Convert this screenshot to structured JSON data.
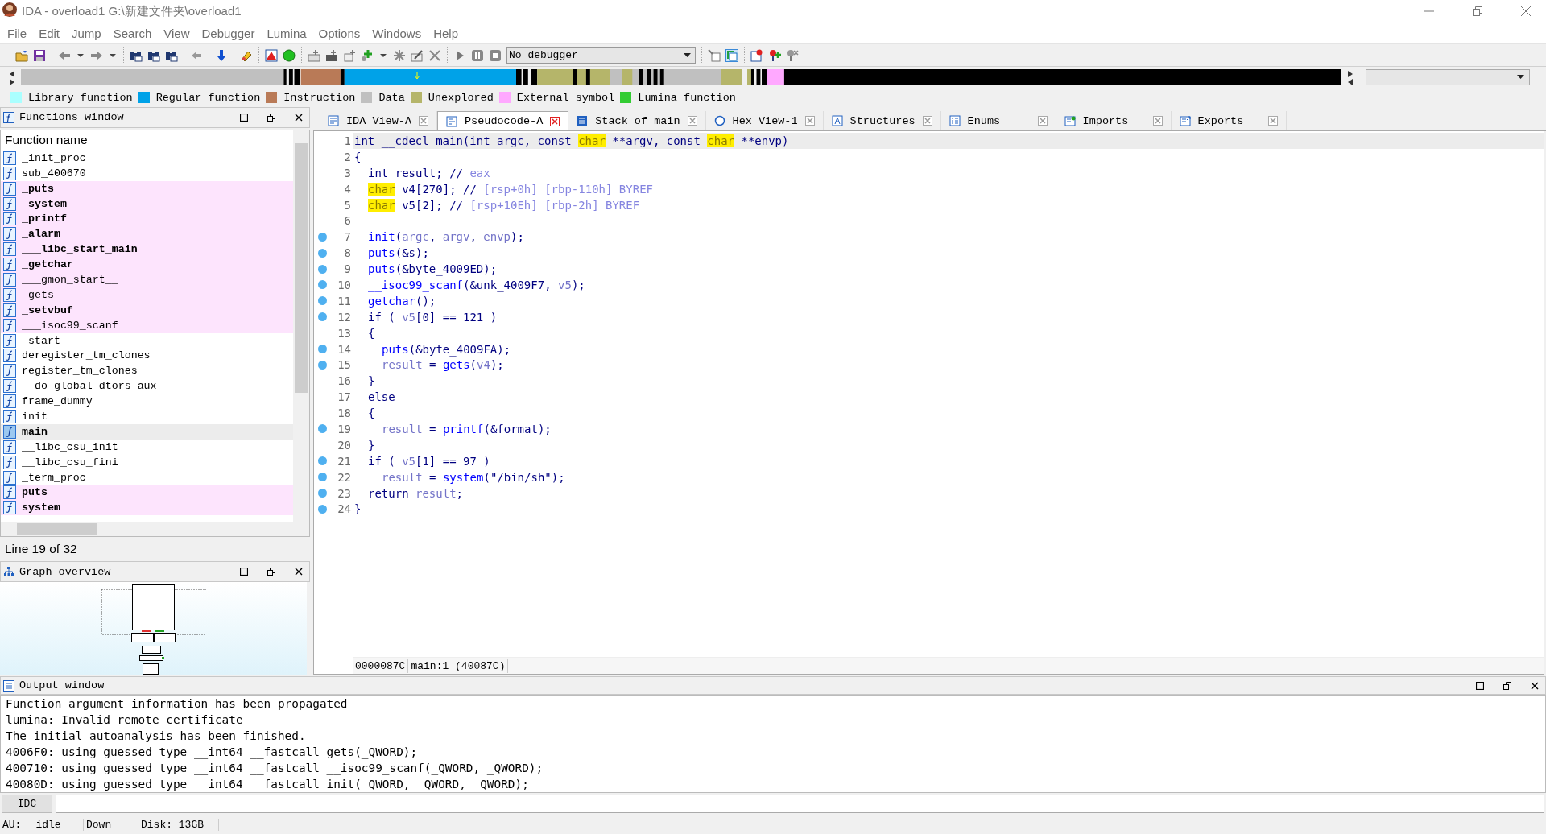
{
  "window": {
    "title": "IDA - overload1 G:\\新建文件夹\\overload1"
  },
  "menu": [
    "File",
    "Edit",
    "Jump",
    "Search",
    "View",
    "Debugger",
    "Lumina",
    "Options",
    "Windows",
    "Help"
  ],
  "toolbar": {
    "debugger_select": "No debugger"
  },
  "legend": [
    {
      "label": "Library function",
      "color": "#aaffff"
    },
    {
      "label": "Regular function",
      "color": "#00a2e8"
    },
    {
      "label": "Instruction",
      "color": "#b97a57"
    },
    {
      "label": "Data",
      "color": "#c0c0c0"
    },
    {
      "label": "Unexplored",
      "color": "#b5b56a"
    },
    {
      "label": "External symbol",
      "color": "#ffa8ff"
    },
    {
      "label": "Lumina function",
      "color": "#33cc33"
    }
  ],
  "functions_window": {
    "title": "Functions window",
    "column": "Function name",
    "status": "Line 19 of 32",
    "rows": [
      {
        "name": "_init_proc",
        "external": false,
        "bold": false,
        "selected": false
      },
      {
        "name": "sub_400670",
        "external": false,
        "bold": false,
        "selected": false
      },
      {
        "name": "_puts",
        "external": true,
        "bold": true,
        "selected": false
      },
      {
        "name": "_system",
        "external": true,
        "bold": true,
        "selected": false
      },
      {
        "name": "_printf",
        "external": true,
        "bold": true,
        "selected": false
      },
      {
        "name": "_alarm",
        "external": true,
        "bold": true,
        "selected": false
      },
      {
        "name": "___libc_start_main",
        "external": true,
        "bold": true,
        "selected": false
      },
      {
        "name": "_getchar",
        "external": true,
        "bold": true,
        "selected": false
      },
      {
        "name": "___gmon_start__",
        "external": true,
        "bold": false,
        "selected": false
      },
      {
        "name": "_gets",
        "external": true,
        "bold": false,
        "selected": false
      },
      {
        "name": "_setvbuf",
        "external": true,
        "bold": true,
        "selected": false
      },
      {
        "name": "___isoc99_scanf",
        "external": true,
        "bold": false,
        "selected": false
      },
      {
        "name": "_start",
        "external": false,
        "bold": false,
        "selected": false
      },
      {
        "name": "deregister_tm_clones",
        "external": false,
        "bold": false,
        "selected": false
      },
      {
        "name": "register_tm_clones",
        "external": false,
        "bold": false,
        "selected": false
      },
      {
        "name": "__do_global_dtors_aux",
        "external": false,
        "bold": false,
        "selected": false
      },
      {
        "name": "frame_dummy",
        "external": false,
        "bold": false,
        "selected": false
      },
      {
        "name": "init",
        "external": false,
        "bold": false,
        "selected": false
      },
      {
        "name": "main",
        "external": false,
        "bold": true,
        "selected": true
      },
      {
        "name": "__libc_csu_init",
        "external": false,
        "bold": false,
        "selected": false
      },
      {
        "name": "__libc_csu_fini",
        "external": false,
        "bold": false,
        "selected": false
      },
      {
        "name": "_term_proc",
        "external": false,
        "bold": false,
        "selected": false
      },
      {
        "name": "puts",
        "external": true,
        "bold": true,
        "selected": false
      },
      {
        "name": "system",
        "external": true,
        "bold": true,
        "selected": false
      }
    ]
  },
  "graph_overview": {
    "title": "Graph overview"
  },
  "tabs": [
    {
      "label": "IDA View-A",
      "kind": "disasm",
      "selected": false
    },
    {
      "label": "Pseudocode-A",
      "kind": "pseudocode",
      "selected": true
    },
    {
      "label": "Stack of main",
      "kind": "stack",
      "selected": false
    },
    {
      "label": "Hex View-1",
      "kind": "hex",
      "selected": false
    },
    {
      "label": "Structures",
      "kind": "struct",
      "selected": false
    },
    {
      "label": "Enums",
      "kind": "enum",
      "selected": false
    },
    {
      "label": "Imports",
      "kind": "import",
      "selected": false
    },
    {
      "label": "Exports",
      "kind": "export",
      "selected": false
    }
  ],
  "code": {
    "lines": [
      {
        "number": "1",
        "kind": "top",
        "marker": false,
        "selected": true,
        "tokens": [
          {
            "kind": "text",
            "s": "int __cdecl main(int argc, const "
          },
          {
            "kind": "highlight",
            "s": "char"
          },
          {
            "kind": "text",
            "s": " **argv, const "
          },
          {
            "kind": "highlight",
            "s": "char"
          },
          {
            "kind": "text",
            "s": " **envp)"
          }
        ]
      },
      {
        "number": "2",
        "kind": "top",
        "marker": false,
        "selected": false,
        "tokens": [
          {
            "kind": "text",
            "s": "{"
          }
        ]
      },
      {
        "number": "3",
        "kind": "body",
        "marker": false,
        "selected": false,
        "tokens": [
          {
            "kind": "text",
            "s": "int result; // "
          },
          {
            "kind": "comment",
            "s": "eax"
          }
        ]
      },
      {
        "number": "4",
        "kind": "body",
        "marker": false,
        "selected": false,
        "tokens": [
          {
            "kind": "highlight",
            "s": "char"
          },
          {
            "kind": "text",
            "s": " v4[270]; // "
          },
          {
            "kind": "comment",
            "s": "[rsp+0h] [rbp-110h] BYREF"
          }
        ]
      },
      {
        "number": "5",
        "kind": "body",
        "marker": false,
        "selected": false,
        "tokens": [
          {
            "kind": "highlight",
            "s": "char"
          },
          {
            "kind": "text",
            "s": " v5[2]; // "
          },
          {
            "kind": "comment",
            "s": "[rsp+10Eh] [rbp-2h] BYREF"
          }
        ]
      },
      {
        "number": "6",
        "kind": "body",
        "marker": false,
        "selected": false
      },
      {
        "number": "7",
        "kind": "body",
        "marker": true,
        "selected": false,
        "tokens": [
          {
            "kind": "func",
            "s": "init"
          },
          {
            "kind": "text",
            "s": "("
          },
          {
            "kind": "var",
            "s": "argc"
          },
          {
            "kind": "text",
            "s": ", "
          },
          {
            "kind": "var",
            "s": "argv"
          },
          {
            "kind": "text",
            "s": ", "
          },
          {
            "kind": "var",
            "s": "envp"
          },
          {
            "kind": "text",
            "s": ");"
          }
        ]
      },
      {
        "number": "8",
        "kind": "body",
        "marker": true,
        "selected": false,
        "tokens": [
          {
            "kind": "func",
            "s": "puts"
          },
          {
            "kind": "text",
            "s": "(&s);"
          }
        ]
      },
      {
        "number": "9",
        "kind": "body",
        "marker": true,
        "selected": false,
        "tokens": [
          {
            "kind": "func",
            "s": "puts"
          },
          {
            "kind": "text",
            "s": "(&byte_4009ED);"
          }
        ]
      },
      {
        "number": "10",
        "kind": "body",
        "marker": true,
        "selected": false,
        "tokens": [
          {
            "kind": "func",
            "s": "__isoc99_scanf"
          },
          {
            "kind": "text",
            "s": "(&unk_4009F7, "
          },
          {
            "kind": "var",
            "s": "v5"
          },
          {
            "kind": "text",
            "s": ");"
          }
        ]
      },
      {
        "number": "11",
        "kind": "body",
        "marker": true,
        "selected": false,
        "tokens": [
          {
            "kind": "func",
            "s": "getchar"
          },
          {
            "kind": "text",
            "s": "();"
          }
        ]
      },
      {
        "number": "12",
        "kind": "body",
        "marker": true,
        "selected": false,
        "tokens": [
          {
            "kind": "text",
            "s": "if ( "
          },
          {
            "kind": "var",
            "s": "v5"
          },
          {
            "kind": "text",
            "s": "[0] == 121 )"
          }
        ]
      },
      {
        "number": "13",
        "kind": "body",
        "marker": false,
        "selected": false,
        "tokens": [
          {
            "kind": "text",
            "s": "{"
          }
        ]
      },
      {
        "number": "14",
        "kind": "nested",
        "marker": true,
        "selected": false,
        "tokens": [
          {
            "kind": "func",
            "s": "puts"
          },
          {
            "kind": "text",
            "s": "(&byte_4009FA);"
          }
        ]
      },
      {
        "number": "15",
        "kind": "nested",
        "marker": true,
        "selected": false,
        "tokens": [
          {
            "kind": "var",
            "s": "result"
          },
          {
            "kind": "text",
            "s": " = "
          },
          {
            "kind": "func",
            "s": "gets"
          },
          {
            "kind": "text",
            "s": "("
          },
          {
            "kind": "var",
            "s": "v4"
          },
          {
            "kind": "text",
            "s": ");"
          }
        ]
      },
      {
        "number": "16",
        "kind": "body",
        "marker": false,
        "selected": false,
        "tokens": [
          {
            "kind": "text",
            "s": "}"
          }
        ]
      },
      {
        "number": "17",
        "kind": "body",
        "marker": false,
        "selected": false,
        "tokens": [
          {
            "kind": "text",
            "s": "else"
          }
        ]
      },
      {
        "number": "18",
        "kind": "body",
        "marker": false,
        "selected": false,
        "tokens": [
          {
            "kind": "text",
            "s": "{"
          }
        ]
      },
      {
        "number": "19",
        "kind": "nested",
        "marker": true,
        "selected": false,
        "tokens": [
          {
            "kind": "var",
            "s": "result"
          },
          {
            "kind": "text",
            "s": " = "
          },
          {
            "kind": "func",
            "s": "printf"
          },
          {
            "kind": "text",
            "s": "(&format);"
          }
        ]
      },
      {
        "number": "20",
        "kind": "body",
        "marker": false,
        "selected": false,
        "tokens": [
          {
            "kind": "text",
            "s": "}"
          }
        ]
      },
      {
        "number": "21",
        "kind": "body",
        "marker": true,
        "selected": false,
        "tokens": [
          {
            "kind": "text",
            "s": "if ( "
          },
          {
            "kind": "var",
            "s": "v5"
          },
          {
            "kind": "text",
            "s": "[1] == 97 )"
          }
        ]
      },
      {
        "number": "22",
        "kind": "nested",
        "marker": true,
        "selected": false,
        "tokens": [
          {
            "kind": "var",
            "s": "result"
          },
          {
            "kind": "text",
            "s": " = "
          },
          {
            "kind": "func",
            "s": "system"
          },
          {
            "kind": "text",
            "s": "(\"/bin/sh\");"
          }
        ]
      },
      {
        "number": "23",
        "kind": "body",
        "marker": true,
        "selected": false,
        "tokens": [
          {
            "kind": "text",
            "s": "return "
          },
          {
            "kind": "var",
            "s": "result"
          },
          {
            "kind": "text",
            "s": ";"
          }
        ]
      },
      {
        "number": "24",
        "kind": "top",
        "marker": true,
        "selected": false,
        "tokens": [
          {
            "kind": "text",
            "s": "}"
          }
        ]
      }
    ],
    "status_address": "0000087C",
    "status_location": "main:1 (40087C)"
  },
  "output_window": {
    "title": "Output window",
    "lines": [
      "Function argument information has been propagated",
      "lumina: Invalid remote certificate",
      "The initial autoanalysis has been finished.",
      "4006F0: using guessed type __int64 __fastcall gets(_QWORD);",
      "400710: using guessed type __int64 __fastcall __isoc99_scanf(_QWORD, _QWORD);",
      "40080D: using guessed type __int64 __fastcall init(_QWORD, _QWORD, _QWORD);"
    ],
    "idc_button": "IDC"
  },
  "status_bar": [
    {
      "label": "AU:",
      "value": "idle"
    },
    {
      "label": "Down"
    },
    {
      "label": "Disk: 13GB"
    }
  ]
}
